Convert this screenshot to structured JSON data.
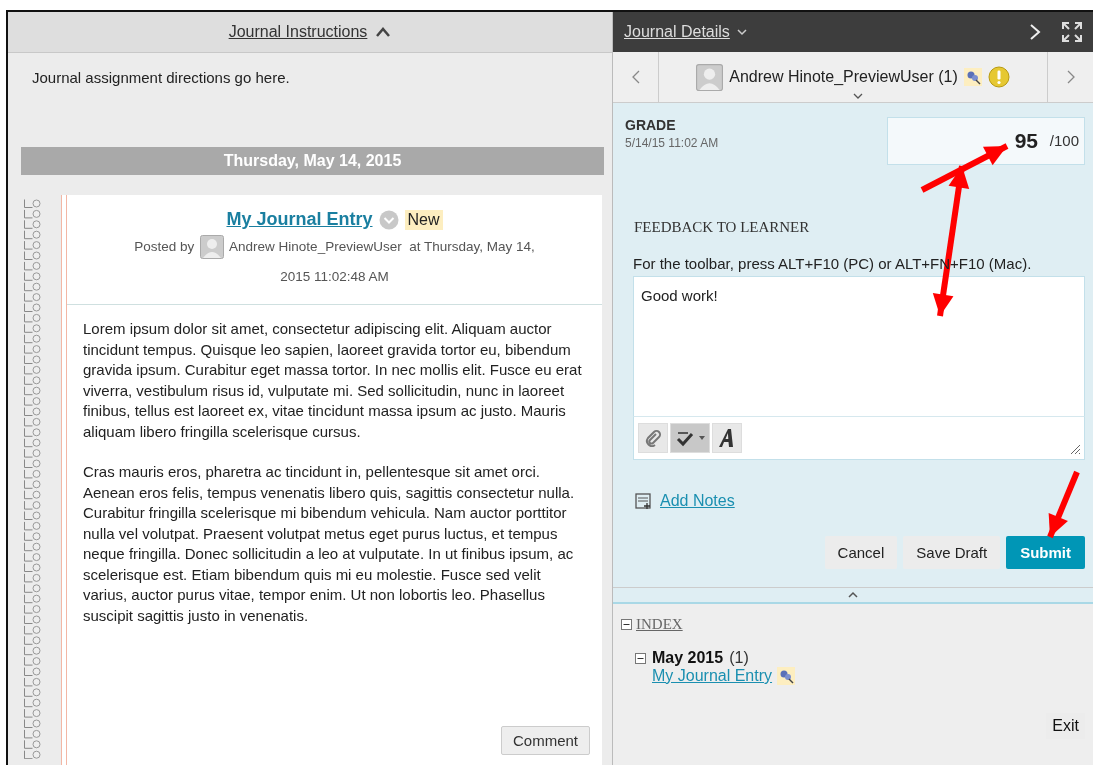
{
  "instructions": {
    "title": "Journal Instructions",
    "expanded": true,
    "text": "Journal assignment directions go here."
  },
  "date_header": "Thursday, May 14, 2015",
  "entry": {
    "title": "My Journal Entry",
    "badge": "New",
    "posted_by_label": "Posted by",
    "author": "Andrew Hinote_PreviewUser",
    "posted_at_lines": [
      "at Thursday, May 14,",
      "2015 11:02:48 AM"
    ],
    "paragraphs": [
      "Lorem ipsum dolor sit amet, consectetur adipiscing elit. Aliquam auctor tincidunt tempus. Quisque leo sapien, laoreet gravida tortor eu, bibendum gravida ipsum. Curabitur eget massa tortor. In nec mollis elit. Fusce eu erat viverra, vestibulum risus id, vulputate mi. Sed sollicitudin, nunc in laoreet finibus, tellus est laoreet ex, vitae tincidunt massa ipsum ac justo. Mauris aliquam libero fringilla scelerisque cursus.",
      "Cras mauris eros, pharetra ac tincidunt in, pellentesque sit amet orci. Aenean eros felis, tempus venenatis libero quis, sagittis consectetur nulla. Curabitur fringilla scelerisque mi bibendum vehicula. Nam auctor porttitor nulla vel volutpat. Praesent volutpat metus eget purus luctus, et tempus neque fringilla. Donec sollicitudin a leo at vulputate. In ut finibus ipsum, ac scelerisque est. Etiam bibendum quis mi eu molestie. Fusce sed velit varius, auctor purus vitae, tempor enim. Ut non lobortis leo. Phasellus suscipit sagittis justo in venenatis."
    ],
    "comment_button": "Comment"
  },
  "details": {
    "title": "Journal Details",
    "user": "Andrew Hinote_PreviewUser (1)",
    "grade": {
      "label": "GRADE",
      "date": "5/14/15 11:02 AM",
      "value": "95",
      "max": "/100"
    },
    "feedback": {
      "label": "FEEDBACK TO LEARNER",
      "hint": "For the toolbar, press ALT+F10 (PC) or ALT+FN+F10 (Mac).",
      "value": "Good work!"
    },
    "add_notes": "Add Notes",
    "buttons": [
      {
        "label": "Cancel",
        "kind": "plain"
      },
      {
        "label": "Save Draft",
        "kind": "plain"
      },
      {
        "label": "Submit",
        "kind": "primary"
      }
    ]
  },
  "index": {
    "title": "INDEX",
    "expanded": true,
    "groups": [
      {
        "label": "May 2015",
        "count": "(1)",
        "expanded": true,
        "children": [
          {
            "label": "My Journal Entry"
          }
        ]
      }
    ]
  },
  "exit": "Exit"
}
